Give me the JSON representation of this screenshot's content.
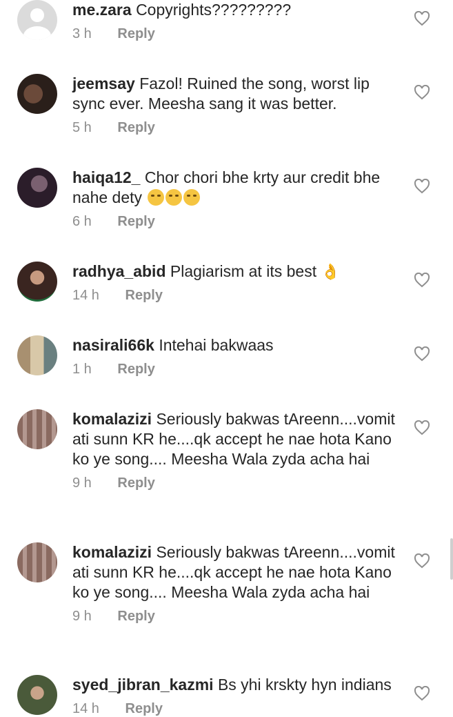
{
  "comments": [
    {
      "username": "me.zara",
      "text": "Copyrights?????????",
      "time": "3 h",
      "reply": "Reply"
    },
    {
      "username": "jeemsay",
      "text": "Fazol! Ruined the song, worst lip sync ever. Meesha sang it was better.",
      "time": "5 h",
      "reply": "Reply"
    },
    {
      "username": "haiqa12_",
      "text": "Chor chori bhe krty aur credit bhe nahe dety",
      "time": "6 h",
      "reply": "Reply",
      "emojis": [
        "rolling-eyes-emoji",
        "unamused-emoji",
        "unamused-emoji"
      ]
    },
    {
      "username": "radhya_abid",
      "text": "Plagiarism at its best",
      "time": "14 h",
      "reply": "Reply",
      "emojis": [
        "ok-hand-emoji"
      ]
    },
    {
      "username": "nasirali66k",
      "text": "Intehai bakwaas",
      "time": "1 h",
      "reply": "Reply"
    },
    {
      "username": "komalazizi",
      "text": "Seriously bakwas tAreenn....vomit ati sunn KR he....qk accept he nae hota Kano ko ye song.... Meesha Wala zyda acha hai",
      "time": "9 h",
      "reply": "Reply"
    },
    {
      "username": "komalazizi",
      "text": "Seriously bakwas tAreenn....vomit ati sunn KR he....qk accept he nae hota Kano ko ye song.... Meesha Wala zyda acha hai",
      "time": "9 h",
      "reply": "Reply"
    },
    {
      "username": "syed_jibran_kazmi",
      "text": "Bs yhi krskty hyn indians",
      "time": "14 h",
      "reply": "Reply"
    }
  ],
  "colors": {
    "text": "#262626",
    "meta": "#8e8e8e",
    "heart": "#8e8e8e"
  }
}
